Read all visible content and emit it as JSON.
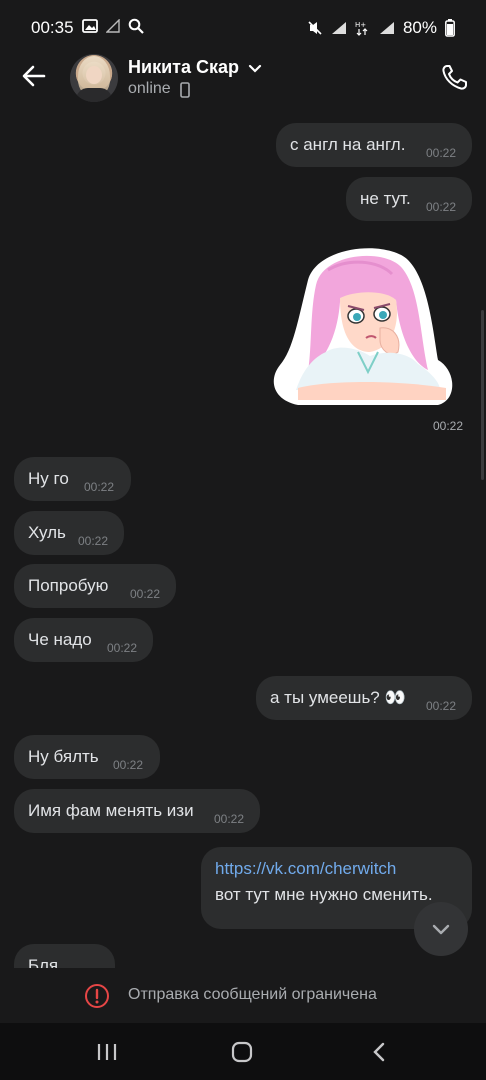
{
  "status_bar": {
    "time": "00:35",
    "battery": "80%",
    "icons": [
      "image-icon",
      "signal-icon",
      "search-icon",
      "mute-icon",
      "wifi-icon",
      "data-icon",
      "signal-icon",
      "battery-icon"
    ]
  },
  "header": {
    "name": "Никита Скар",
    "status": "online"
  },
  "messages": [
    {
      "side": "out",
      "text": "с англ на англ.",
      "time": "00:22"
    },
    {
      "side": "out",
      "text": "не тут.",
      "time": "00:22"
    },
    {
      "side": "out",
      "type": "sticker",
      "time": "00:22"
    },
    {
      "side": "in",
      "text": "Ну го",
      "time": "00:22"
    },
    {
      "side": "in",
      "text": "Хуль",
      "time": "00:22"
    },
    {
      "side": "in",
      "text": "Попробую",
      "time": "00:22"
    },
    {
      "side": "in",
      "text": "Че надо",
      "time": "00:22"
    },
    {
      "side": "out",
      "text": "а ты умеешь? 👀",
      "time": "00:22"
    },
    {
      "side": "in",
      "text": "Ну бялть",
      "time": "00:22"
    },
    {
      "side": "in",
      "text": "Имя фам менять изи",
      "time": "00:22"
    },
    {
      "side": "out",
      "link": "https://vk.com/cherwitch",
      "text": "вот тут мне нужно сменить."
    },
    {
      "side": "in",
      "text": "Бля"
    }
  ],
  "restriction_text": "Отправка сообщений ограничена",
  "colors": {
    "background": "#19191a",
    "bubble": "#2c2d2e",
    "link": "#71aaeb",
    "warning": "#e64646"
  }
}
